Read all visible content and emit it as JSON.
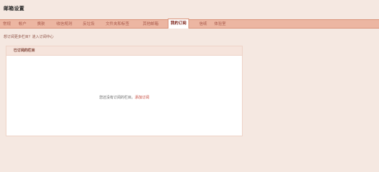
{
  "page": {
    "title": "邮箱设置"
  },
  "tabs": [
    {
      "label": "常规",
      "active": false
    },
    {
      "label": "帐户",
      "active": false
    },
    {
      "label": "换肤",
      "active": false
    },
    {
      "label": "收信规则",
      "active": false
    },
    {
      "label": "反垃圾",
      "active": false
    },
    {
      "label": "文件夹和标签",
      "active": false
    },
    {
      "label": "其他邮箱",
      "active": false
    },
    {
      "label": "我的订阅",
      "active": true
    },
    {
      "label": "信纸",
      "active": false
    },
    {
      "label": "体验室",
      "active": false
    }
  ],
  "subtitle": {
    "text": "想订阅更多栏目？",
    "link": "进入订阅中心"
  },
  "panel": {
    "header": "已订阅的栏目",
    "empty_text": "您还没有订阅的栏目。",
    "add_link": "添加订阅"
  },
  "colors": {
    "background": "#f5e8e1",
    "tabbar": "#ecb6a2",
    "tab_text": "#a7584a",
    "active_tab_text": "#7a1f14",
    "link": "#c0392b"
  }
}
